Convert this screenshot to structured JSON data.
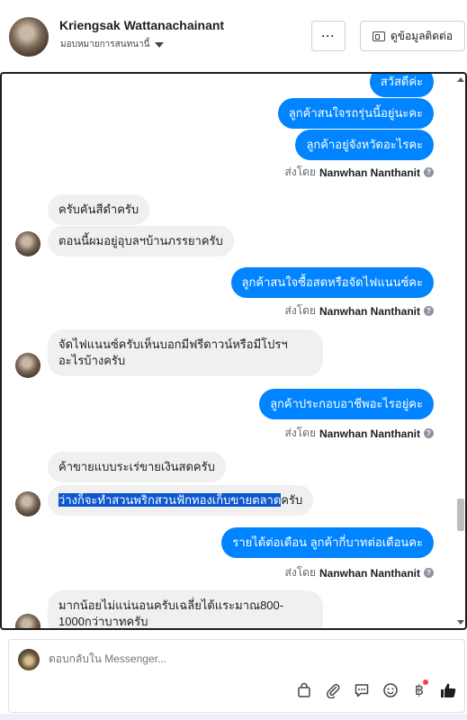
{
  "header": {
    "name": "Kriengsak Wattanachainant",
    "assign_label": "มอบหมายการสนทนานี้",
    "more_label": "···",
    "contact_label": "ดูข้อมูลติดต่อ"
  },
  "messages": {
    "m0": "สวัสดีค่ะ",
    "m1": "ลูกค้าสนใจรถรุ่นนี้อยู่นะคะ",
    "m2": "ลูกค้าอยู่จังหวัดอะไรคะ",
    "m3": "ครับคันสีดำครับ",
    "m4": "ตอนนี้ผมอยู่อุบลฯบ้านภรรยาครับ",
    "m5": "ลูกค้าสนใจซื้อสดหรือจัดไฟแนนซ์คะ",
    "m6": "จัดไฟแนนซ์ครับเห็นบอกมีฟรีดาวน์หรือมีโปรฯอะไรบ้างครับ",
    "m7": "ลูกค้าประกอบอาชีพอะไรอยู่คะ",
    "m8": "ค้าขายแบบระเร่ขายเงินสดครับ",
    "m9_selected": "ว่างก็จะทำสวนพริกสวนฟักทองเก็บขายตลาด",
    "m9_rest": "ครับ",
    "m10": "รายได้ต่อเดือน ลูกค้ากี่บาทต่อเดือนคะ",
    "m11": "มากน้อยไม่แน่นอนครับเฉลี่ยได้แระมาณ800-1000กว่าบาทครับ"
  },
  "sent_by": {
    "prefix": "ส่งโดย",
    "name": "Nanwhan Nanthanit",
    "info_icon": "?"
  },
  "composer": {
    "placeholder": "ตอบกลับใน Messenger...",
    "baht_symbol": "฿"
  },
  "colors": {
    "outgoing_bubble": "#0084ff",
    "incoming_bubble": "#f0f0f0",
    "notification_dot": "#fa3e3e"
  }
}
